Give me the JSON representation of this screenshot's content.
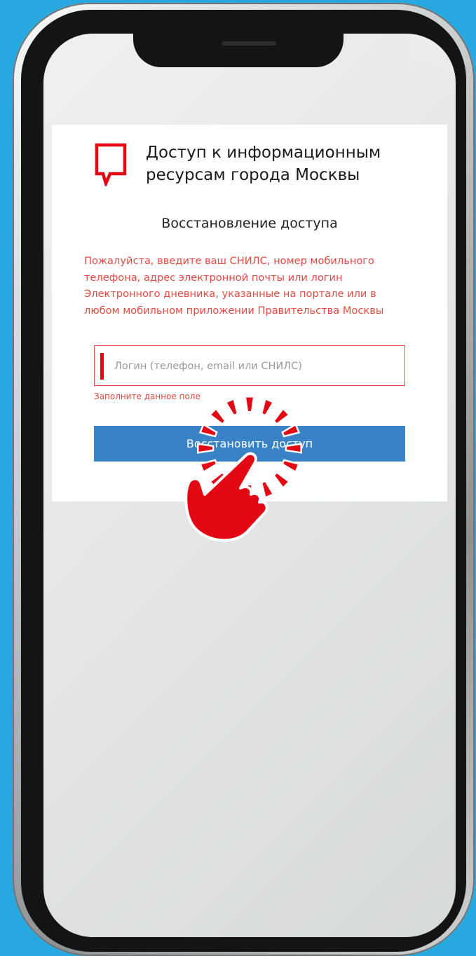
{
  "page": {
    "brand_title": "Доступ к информационным ресурсам города Москвы",
    "section_title": "Восстановление доступа",
    "hint": "Пожалуйста, введите ваш СНИЛС, номер мобильного телефона, адрес электронной почты или логин Электронного дневника, указанные на портале или в любом мобильном приложении Правительства Москвы",
    "login_placeholder": "Логин (телефон, email или СНИЛС)",
    "login_value": "",
    "login_error": "Заполните данное поле",
    "submit_label": "Восстановить доступ"
  },
  "icons": {
    "logo": "mos-speech-bubble-logo",
    "tap": "hand-tap-icon"
  },
  "colors": {
    "background": "#27a8e0",
    "accent_red": "#e30613",
    "error_text": "#e34a43",
    "button_blue": "#3982c6"
  }
}
